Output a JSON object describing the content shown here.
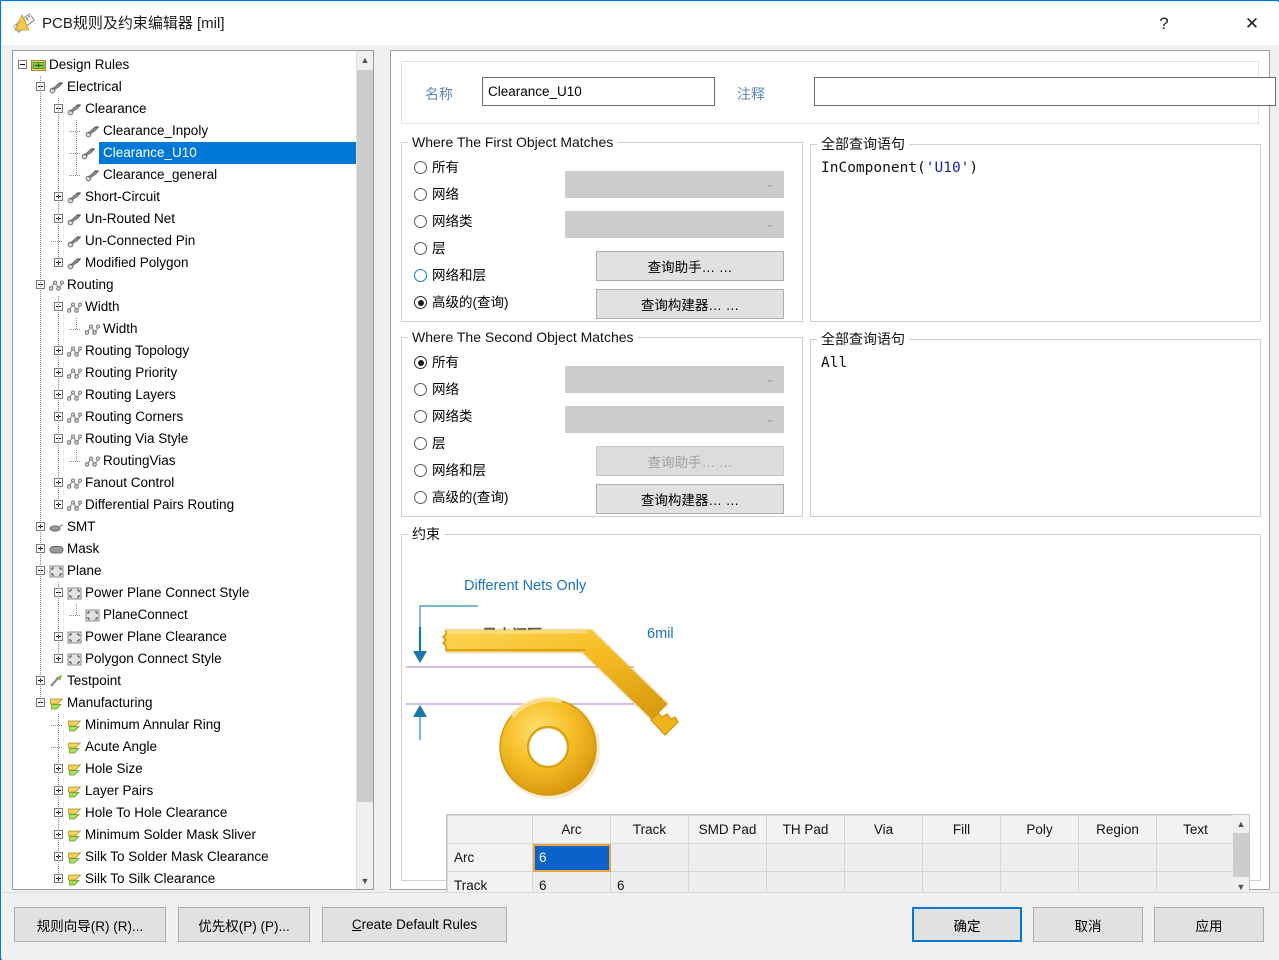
{
  "window": {
    "title": "PCB规则及约束编辑器 [mil]",
    "icon": "ruler-icon",
    "help_label": "?",
    "close_label": "✕"
  },
  "tree": {
    "root_label": "Design Rules",
    "selected": "Clearance_U10",
    "items": [
      {
        "label": "Design Rules",
        "depth": 0,
        "state": "minus",
        "icon": "folder-rules-icon"
      },
      {
        "label": "Electrical",
        "depth": 1,
        "state": "minus",
        "icon": "electrical-icon"
      },
      {
        "label": "Clearance",
        "depth": 2,
        "state": "minus",
        "icon": "electrical-icon"
      },
      {
        "label": "Clearance_Inpoly",
        "depth": 3,
        "state": "leaf",
        "icon": "electrical-icon"
      },
      {
        "label": "Clearance_U10",
        "depth": 3,
        "state": "leaf",
        "icon": "electrical-icon",
        "selected": true
      },
      {
        "label": "Clearance_general",
        "depth": 3,
        "state": "leaf-last",
        "icon": "electrical-icon"
      },
      {
        "label": "Short-Circuit",
        "depth": 2,
        "state": "plus",
        "icon": "electrical-icon"
      },
      {
        "label": "Un-Routed Net",
        "depth": 2,
        "state": "plus",
        "icon": "electrical-icon"
      },
      {
        "label": "Un-Connected Pin",
        "depth": 2,
        "state": "leaf",
        "icon": "electrical-icon"
      },
      {
        "label": "Modified Polygon",
        "depth": 2,
        "state": "plus",
        "icon": "electrical-icon"
      },
      {
        "label": "Routing",
        "depth": 1,
        "state": "minus",
        "icon": "routing-icon"
      },
      {
        "label": "Width",
        "depth": 2,
        "state": "minus",
        "icon": "routing-icon"
      },
      {
        "label": "Width",
        "depth": 3,
        "state": "leaf-last",
        "icon": "routing-icon"
      },
      {
        "label": "Routing Topology",
        "depth": 2,
        "state": "plus",
        "icon": "routing-icon"
      },
      {
        "label": "Routing Priority",
        "depth": 2,
        "state": "plus",
        "icon": "routing-icon"
      },
      {
        "label": "Routing Layers",
        "depth": 2,
        "state": "plus",
        "icon": "routing-icon"
      },
      {
        "label": "Routing Corners",
        "depth": 2,
        "state": "plus",
        "icon": "routing-icon"
      },
      {
        "label": "Routing Via Style",
        "depth": 2,
        "state": "minus",
        "icon": "routing-icon"
      },
      {
        "label": "RoutingVias",
        "depth": 3,
        "state": "leaf-last",
        "icon": "routing-icon"
      },
      {
        "label": "Fanout Control",
        "depth": 2,
        "state": "plus",
        "icon": "routing-icon"
      },
      {
        "label": "Differential Pairs Routing",
        "depth": 2,
        "state": "plus",
        "icon": "routing-icon"
      },
      {
        "label": "SMT",
        "depth": 1,
        "state": "plus",
        "icon": "smt-icon"
      },
      {
        "label": "Mask",
        "depth": 1,
        "state": "plus",
        "icon": "mask-icon"
      },
      {
        "label": "Plane",
        "depth": 1,
        "state": "minus",
        "icon": "plane-icon"
      },
      {
        "label": "Power Plane Connect Style",
        "depth": 2,
        "state": "minus",
        "icon": "plane-icon"
      },
      {
        "label": "PlaneConnect",
        "depth": 3,
        "state": "leaf-last",
        "icon": "plane-icon"
      },
      {
        "label": "Power Plane Clearance",
        "depth": 2,
        "state": "plus",
        "icon": "plane-icon"
      },
      {
        "label": "Polygon Connect Style",
        "depth": 2,
        "state": "plus",
        "icon": "plane-icon"
      },
      {
        "label": "Testpoint",
        "depth": 1,
        "state": "plus",
        "icon": "testpoint-icon"
      },
      {
        "label": "Manufacturing",
        "depth": 1,
        "state": "minus",
        "icon": "manufacturing-icon"
      },
      {
        "label": "Minimum Annular Ring",
        "depth": 2,
        "state": "leaf",
        "icon": "manufacturing-icon"
      },
      {
        "label": "Acute Angle",
        "depth": 2,
        "state": "leaf",
        "icon": "manufacturing-icon"
      },
      {
        "label": "Hole Size",
        "depth": 2,
        "state": "plus",
        "icon": "manufacturing-icon"
      },
      {
        "label": "Layer Pairs",
        "depth": 2,
        "state": "plus",
        "icon": "manufacturing-icon"
      },
      {
        "label": "Hole To Hole Clearance",
        "depth": 2,
        "state": "plus",
        "icon": "manufacturing-icon"
      },
      {
        "label": "Minimum Solder Mask Sliver",
        "depth": 2,
        "state": "plus",
        "icon": "manufacturing-icon"
      },
      {
        "label": "Silk To Solder Mask Clearance",
        "depth": 2,
        "state": "plus",
        "icon": "manufacturing-icon"
      },
      {
        "label": "Silk To Silk Clearance",
        "depth": 2,
        "state": "plus",
        "icon": "manufacturing-icon"
      }
    ]
  },
  "header": {
    "name_label": "名称",
    "name_value": "Clearance_U10",
    "comment_label": "注释",
    "comment_value": ""
  },
  "first_object": {
    "legend": "Where The First Object Matches",
    "options": [
      "所有",
      "网络",
      "网络类",
      "层",
      "网络和层",
      "高级的(查询)"
    ],
    "selected_index": 5,
    "hovered_index": 4,
    "combo1_value": "",
    "combo2_value": "",
    "helper_button": "查询助手… …",
    "builder_button": "查询构建器… …",
    "helper_enabled": true
  },
  "second_object": {
    "legend": "Where The Second Object Matches",
    "options": [
      "所有",
      "网络",
      "网络类",
      "层",
      "网络和层",
      "高级的(查询)"
    ],
    "selected_index": 0,
    "combo1_value": "",
    "combo2_value": "",
    "helper_button": "查询助手… …",
    "builder_button": "查询构建器… …",
    "helper_enabled": false
  },
  "query1": {
    "legend": "全部查询语句",
    "prefix": "InComponent(",
    "arg": "'U10'",
    "suffix": ")"
  },
  "query2": {
    "legend": "全部查询语句",
    "text": "All"
  },
  "constraint": {
    "legend": "约束",
    "different_nets_link": "Different Nets Only",
    "min_clearance_label": "最小间隔",
    "min_clearance_value": "6mil",
    "table": {
      "columns": [
        "",
        "Arc",
        "Track",
        "SMD Pad",
        "TH Pad",
        "Via",
        "Fill",
        "Poly",
        "Region",
        "Text"
      ],
      "rows": [
        {
          "header": "Arc",
          "cells": [
            "6",
            "",
            "",
            "",
            "",
            "",
            "",
            "",
            ""
          ],
          "selected_col": 1
        },
        {
          "header": "Track",
          "cells": [
            "6",
            "6",
            "",
            "",
            "",
            "",
            "",
            "",
            ""
          ],
          "selected_col": -1
        }
      ]
    }
  },
  "footer": {
    "rule_wizard": "规则向导(R) (R)...",
    "priority": "优先权(P) (P)...",
    "create_default": "Create Default Rules",
    "create_default_accel": "C",
    "create_default_rest": "reate Default Rules",
    "ok": "确定",
    "cancel": "取消",
    "apply": "应用"
  },
  "colors": {
    "accent": "#0078d7",
    "selection": "#0a63c8",
    "link": "#1a73c4",
    "gold": "#f0b429"
  }
}
